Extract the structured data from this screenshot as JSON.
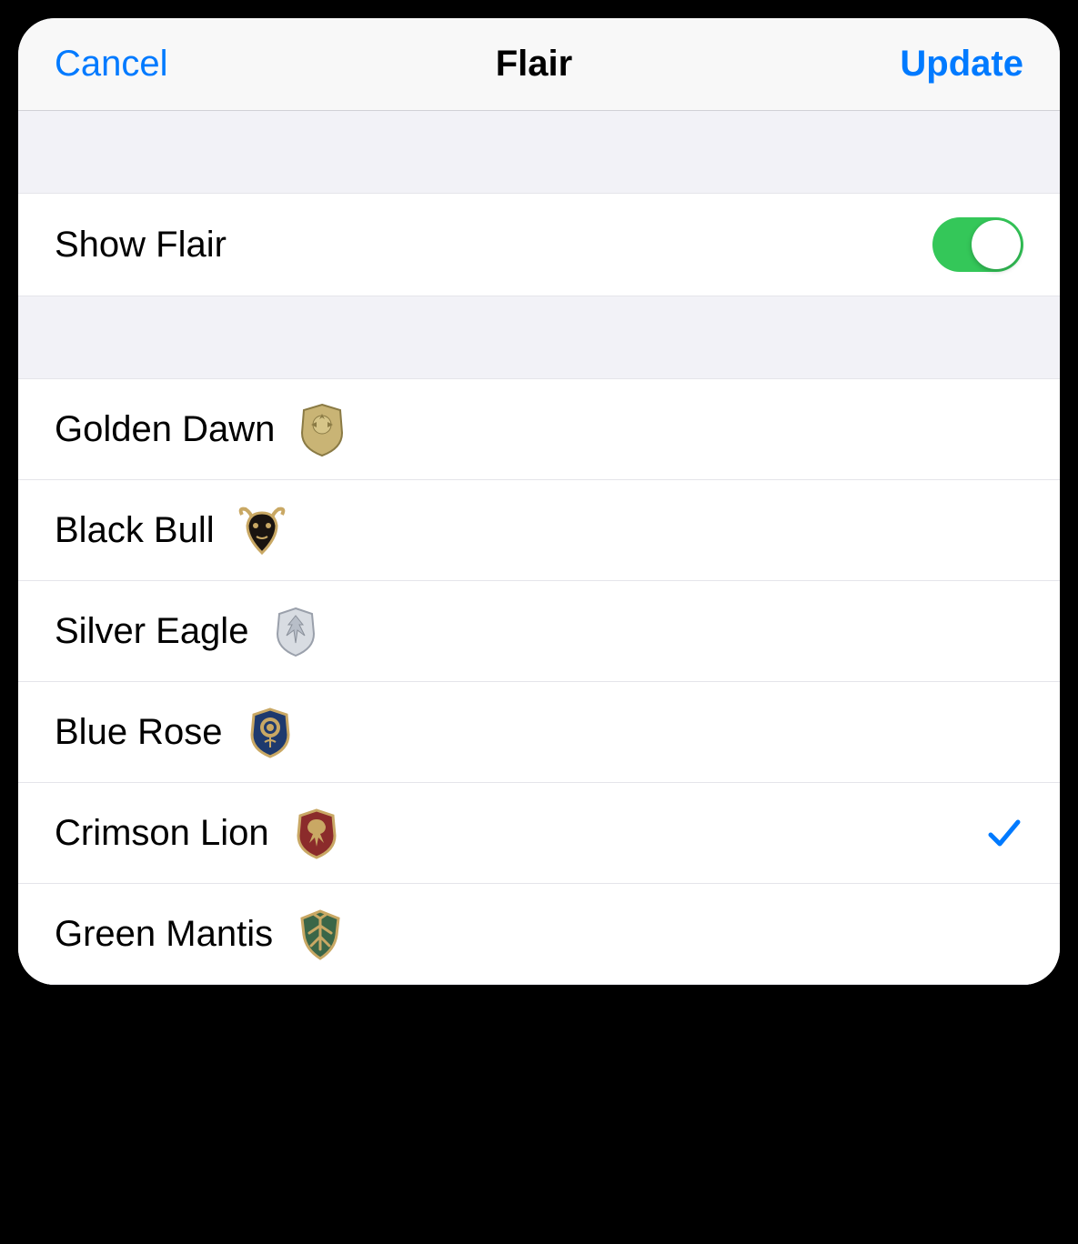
{
  "navbar": {
    "cancel_label": "Cancel",
    "title": "Flair",
    "update_label": "Update"
  },
  "settings": {
    "show_flair_label": "Show Flair",
    "show_flair_value": true
  },
  "flairs": [
    {
      "label": "Golden Dawn",
      "icon": "golden-dawn",
      "selected": false
    },
    {
      "label": "Black Bull",
      "icon": "black-bull",
      "selected": false
    },
    {
      "label": "Silver Eagle",
      "icon": "silver-eagle",
      "selected": false
    },
    {
      "label": "Blue Rose",
      "icon": "blue-rose",
      "selected": false
    },
    {
      "label": "Crimson Lion",
      "icon": "crimson-lion",
      "selected": true
    },
    {
      "label": "Green Mantis",
      "icon": "green-mantis",
      "selected": false
    }
  ],
  "colors": {
    "accent": "#007aff",
    "toggle_on": "#34c759"
  }
}
